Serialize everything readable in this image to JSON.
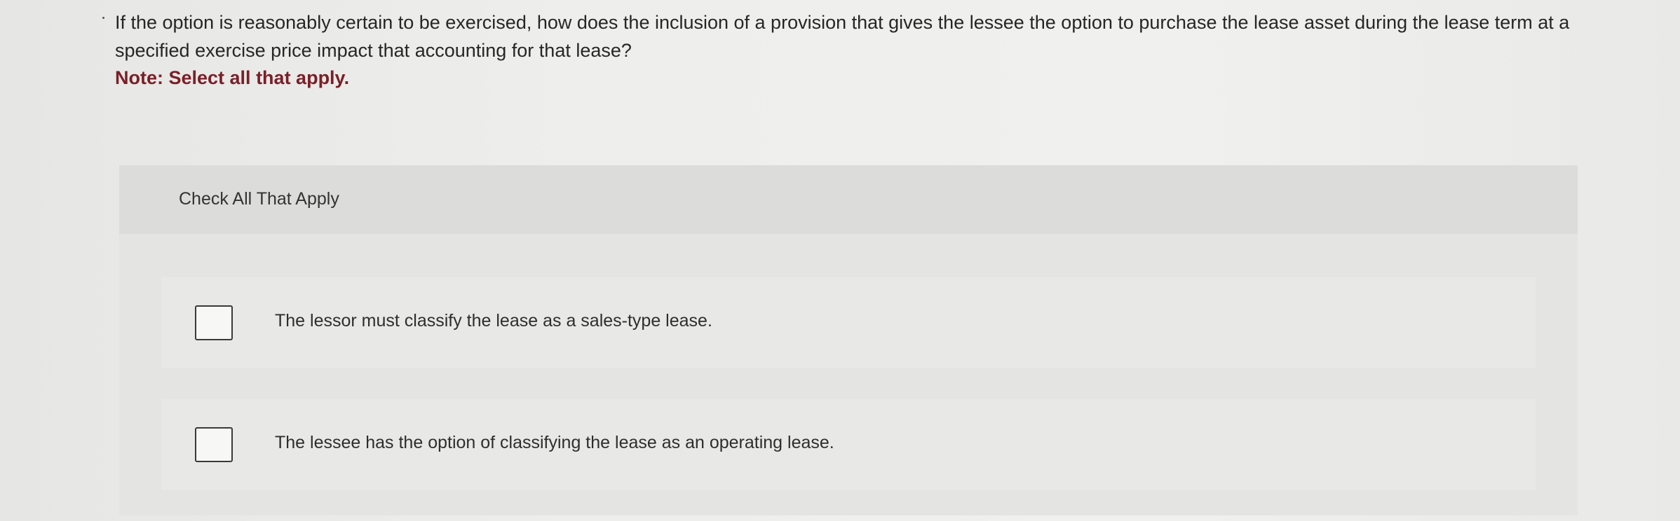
{
  "question": {
    "text": "If the option is reasonably certain to be exercised, how does the inclusion of a provision that gives the lessee the option to purchase the lease asset during the lease term at a specified exercise price impact that accounting for that lease?",
    "note": "Note: Select all that apply."
  },
  "panel": {
    "title": "Check All That Apply",
    "options": [
      {
        "label": "The lessor must classify the lease as a sales-type lease.",
        "checked": false
      },
      {
        "label": "The lessee has the option of classifying the lease as an operating lease.",
        "checked": false
      }
    ]
  },
  "colors": {
    "note": "#7a1f28",
    "panel_header": "#dcdcda",
    "panel_body": "#e4e4e2"
  }
}
